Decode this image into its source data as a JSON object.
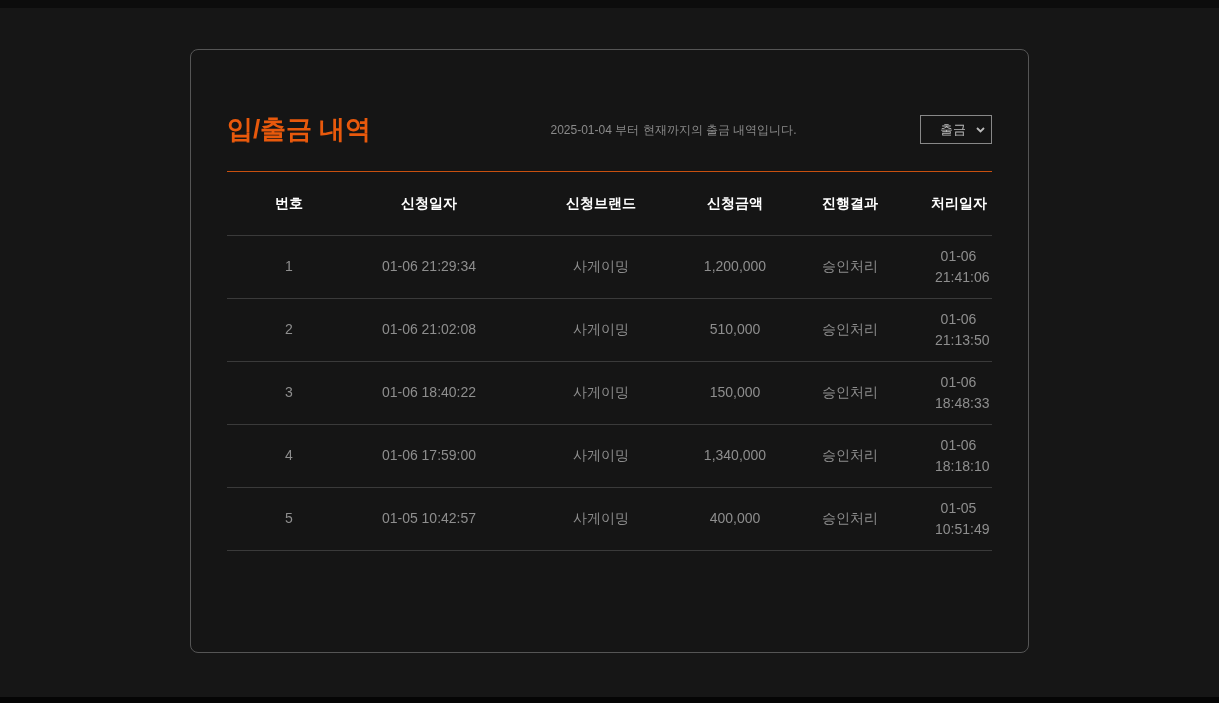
{
  "title": "입/출금 내역",
  "notice": "2025-01-04 부터 현재까지의 출금 내역입니다.",
  "filter": {
    "value": "출금"
  },
  "table": {
    "columns": [
      "번호",
      "신청일자",
      "신청브랜드",
      "신청금액",
      "진행결과",
      "처리일자"
    ],
    "rows": [
      [
        "1",
        "01-06 21:29:34",
        "사게이밍",
        "1,200,000",
        "승인처리",
        "01-06 21:41:06"
      ],
      [
        "2",
        "01-06 21:02:08",
        "사게이밍",
        "510,000",
        "승인처리",
        "01-06 21:13:50"
      ],
      [
        "3",
        "01-06 18:40:22",
        "사게이밍",
        "150,000",
        "승인처리",
        "01-06 18:48:33"
      ],
      [
        "4",
        "01-06 17:59:00",
        "사게이밍",
        "1,340,000",
        "승인처리",
        "01-06 18:18:10"
      ],
      [
        "5",
        "01-05 10:42:57",
        "사게이밍",
        "400,000",
        "승인처리",
        "01-05 10:51:49"
      ]
    ]
  }
}
